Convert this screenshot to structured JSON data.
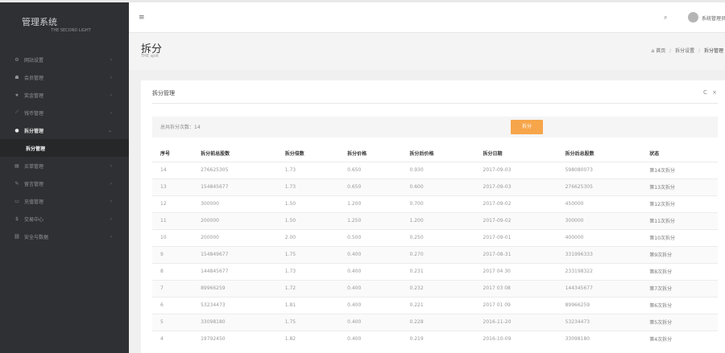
{
  "app": {
    "title": "管理系统",
    "subtitle": "THE SECOND LIGHT"
  },
  "header": {
    "menu_icon": "≡",
    "search_icon": "⌕",
    "username": "系统管理员"
  },
  "sidebar": {
    "items": [
      {
        "icon": "⚙",
        "label": "网站设置"
      },
      {
        "icon": "☗",
        "label": "会员管理"
      },
      {
        "icon": "★",
        "label": "奖金管理"
      },
      {
        "icon": "⟋",
        "label": "钱币管理"
      },
      {
        "icon": "●",
        "label": "拆分管理"
      },
      {
        "icon": "▤",
        "label": "买单管理"
      },
      {
        "icon": "✎",
        "label": "留言管理"
      },
      {
        "icon": "▭",
        "label": "充值管理"
      },
      {
        "icon": "$",
        "label": "交易中心"
      },
      {
        "icon": "⛓",
        "label": "安全与数据"
      }
    ],
    "sub_item": "拆分管理"
  },
  "page": {
    "title": "拆分",
    "subtitle": "THE split",
    "breadcrumb": [
      "首页",
      "拆分设置",
      "拆分管理"
    ]
  },
  "panel": {
    "title": "拆分管理",
    "refresh_icon": "C",
    "close_icon": "×",
    "info": "总共拆分次数：14",
    "split_button": "拆分"
  },
  "table": {
    "columns": [
      "序号",
      "拆分前总股数",
      "拆分倍数",
      "拆分价格",
      "拆分后价格",
      "拆分日期",
      "拆分后总股数",
      "状态"
    ],
    "rows": [
      [
        "14",
        "276625305",
        "1.73",
        "0.650",
        "0.930",
        "2017-09-03",
        "598080073",
        "第14次拆分"
      ],
      [
        "13",
        "154845677",
        "1.73",
        "0.650",
        "0.600",
        "2017-09-03",
        "276625305",
        "第13次拆分"
      ],
      [
        "12",
        "300000",
        "1.50",
        "1.200",
        "0.700",
        "2017-09-02",
        "450000",
        "第12次拆分"
      ],
      [
        "11",
        "200000",
        "1.50",
        "1.250",
        "1.200",
        "2017-09-02",
        "300000",
        "第11次拆分"
      ],
      [
        "10",
        "200000",
        "2.00",
        "0.500",
        "0.250",
        "2017-09-01",
        "400000",
        "第10次拆分"
      ],
      [
        "9",
        "154849677",
        "1.75",
        "0.400",
        "0.270",
        "2017-08-31",
        "331996333",
        "第9次拆分"
      ],
      [
        "8",
        "144845677",
        "1.73",
        "0.400",
        "0.231",
        "2017 04 30",
        "233198322",
        "第8次拆分"
      ],
      [
        "7",
        "89966259",
        "1.72",
        "0.400",
        "0.232",
        "2017 03 08",
        "144345677",
        "第7次拆分"
      ],
      [
        "6",
        "53234473",
        "1.81",
        "0.400",
        "0.221",
        "2017 01 09",
        "89966259",
        "第6次拆分"
      ],
      [
        "5",
        "33098180",
        "1.75",
        "0.400",
        "0.228",
        "2016-11-20",
        "53234473",
        "第5次拆分"
      ],
      [
        "4",
        "19792450",
        "1.82",
        "0.400",
        "0.219",
        "2016-10-09",
        "33098180",
        "第4次拆分"
      ]
    ]
  }
}
